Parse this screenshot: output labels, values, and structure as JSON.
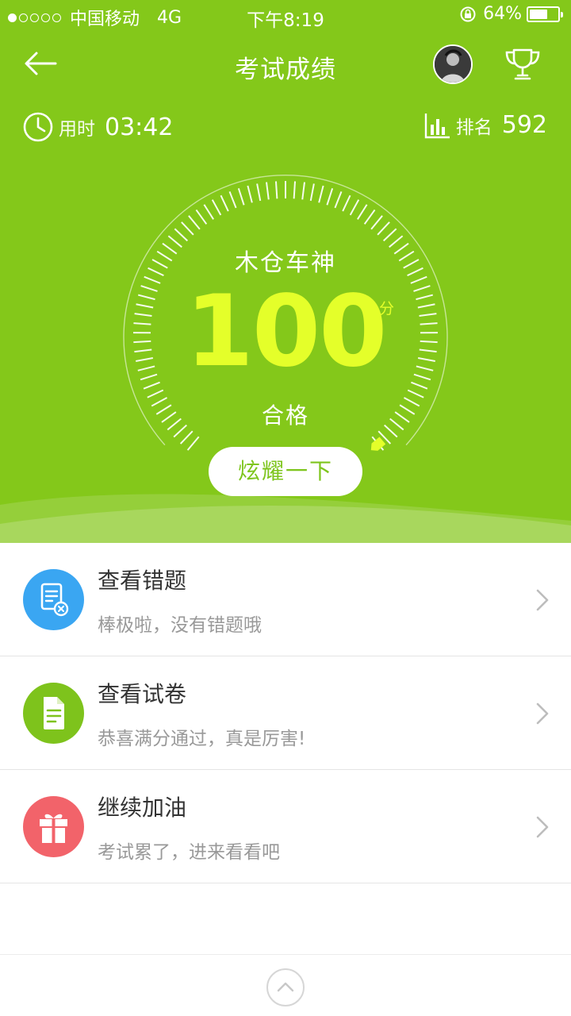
{
  "status_bar": {
    "carrier": "中国移动",
    "network": "4G",
    "time": "下午8:19",
    "battery": "64%",
    "battery_level": 0.64
  },
  "header": {
    "title": "考试成绩",
    "back_icon": "arrow-left-icon",
    "trophy_icon": "trophy-icon"
  },
  "stats": {
    "time_label": "用时",
    "time_value": "03:42",
    "rank_label": "排名",
    "rank_value": "592"
  },
  "result": {
    "title": "木仓车神",
    "score": "100",
    "unit": "分",
    "status": "合格",
    "score_fraction": 1.0,
    "share_button": "炫耀一下"
  },
  "list": [
    {
      "title": "查看错题",
      "subtitle": "棒极啦，没有错题哦",
      "icon": "wrong-questions-icon",
      "color": "#3aa6f2"
    },
    {
      "title": "查看试卷",
      "subtitle": "恭喜满分通过，真是厉害!",
      "icon": "paper-icon",
      "color": "#7ec31c"
    },
    {
      "title": "继续加油",
      "subtitle": "考试累了，进来看看吧",
      "icon": "gift-icon",
      "color": "#f2636a"
    }
  ],
  "colors": {
    "primary": "#84c81a",
    "score": "#e4ff2a",
    "text": "#333333",
    "muted": "#999999"
  }
}
